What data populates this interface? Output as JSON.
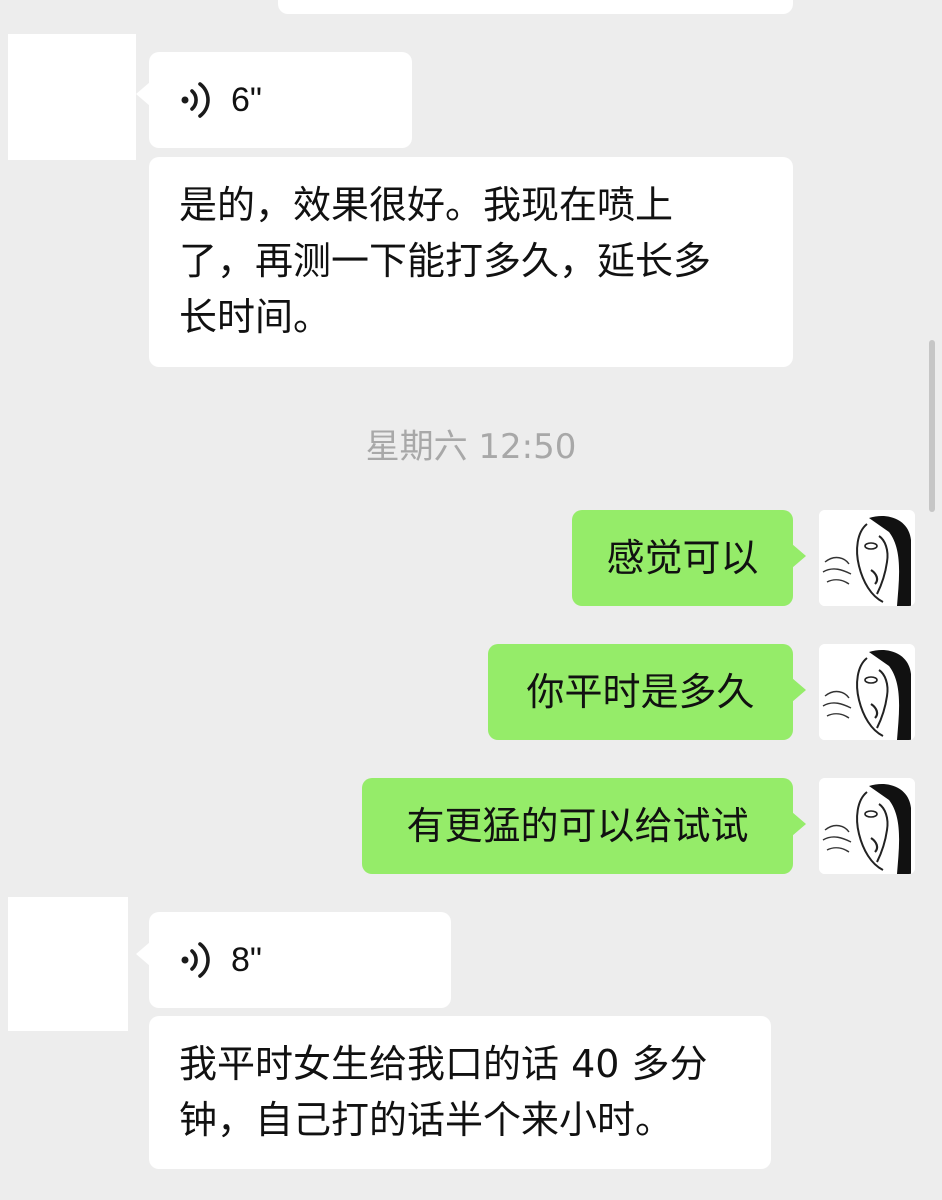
{
  "messages": {
    "voice1": {
      "duration": "6\""
    },
    "text1": {
      "text": "是的，效果很好。我现在喷上\n了，再测一下能打多久，延长多\n长时间。"
    },
    "timestamp": "星期六 12:50",
    "sent1": {
      "text": "感觉可以"
    },
    "sent2": {
      "text": "你平时是多久"
    },
    "sent3": {
      "text": "有更猛的可以给试试"
    },
    "voice2": {
      "duration": "8\""
    },
    "text2": {
      "text": "我平时女生给我口的话 40 多分\n钟，自己打的话半个来小时。"
    }
  },
  "colors": {
    "background": "#ededed",
    "incoming_bubble": "#ffffff",
    "outgoing_bubble": "#95ec69",
    "timestamp_text": "#a8a8a8"
  },
  "icons": {
    "voice": "voice-wave-icon",
    "avatar": "user-avatar-sketch"
  }
}
